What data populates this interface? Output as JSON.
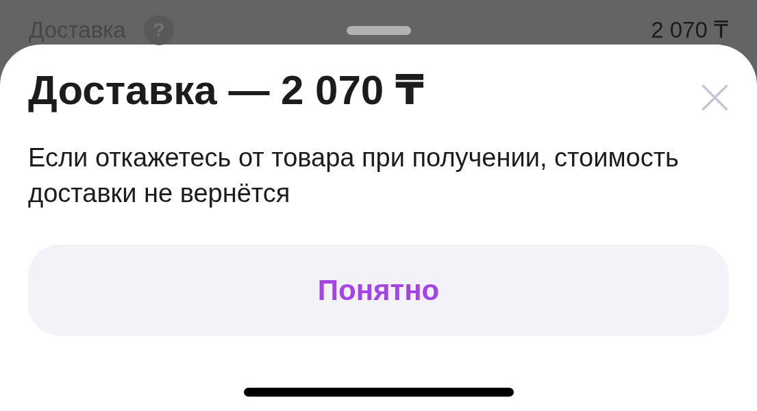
{
  "background_row": {
    "label": "Доставка",
    "help_icon": "?",
    "price": "2 070 ₸"
  },
  "sheet": {
    "title": "Доставка — 2 070 ₸",
    "message": "Если откажетесь от товара при получении, стоимость доставки не вернётся",
    "button": "Понятно"
  }
}
